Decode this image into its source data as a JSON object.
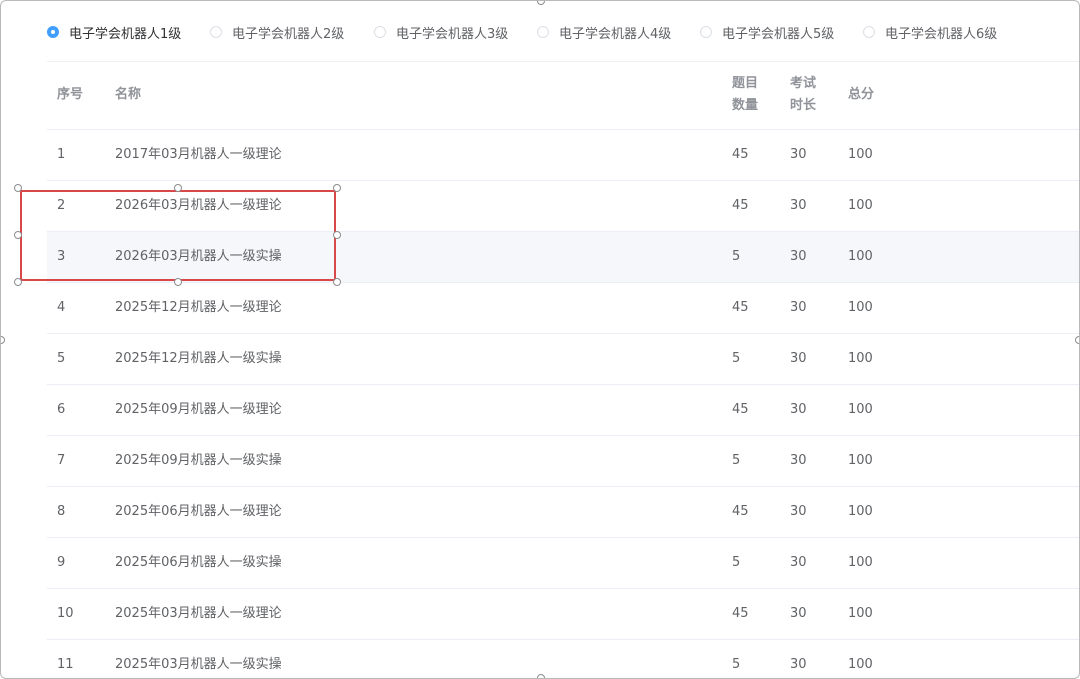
{
  "level_options": [
    {
      "label": "电子学会机器人1级",
      "checked": true
    },
    {
      "label": "电子学会机器人2级",
      "checked": false
    },
    {
      "label": "电子学会机器人3级",
      "checked": false
    },
    {
      "label": "电子学会机器人4级",
      "checked": false
    },
    {
      "label": "电子学会机器人5级",
      "checked": false
    },
    {
      "label": "电子学会机器人6级",
      "checked": false
    }
  ],
  "table": {
    "headers": {
      "no": "序号",
      "name": "名称",
      "questions_line1": "题目",
      "questions_line2": "数量",
      "duration_line1": "考试",
      "duration_line2": "时长",
      "score": "总分"
    },
    "rows": [
      {
        "no": "1",
        "name": "2017年03月机器人一级理论",
        "questions": "45",
        "duration": "30",
        "score": "100"
      },
      {
        "no": "2",
        "name": "2026年03月机器人一级理论",
        "questions": "45",
        "duration": "30",
        "score": "100"
      },
      {
        "no": "3",
        "name": "2026年03月机器人一级实操",
        "questions": "5",
        "duration": "30",
        "score": "100"
      },
      {
        "no": "4",
        "name": "2025年12月机器人一级理论",
        "questions": "45",
        "duration": "30",
        "score": "100"
      },
      {
        "no": "5",
        "name": "2025年12月机器人一级实操",
        "questions": "5",
        "duration": "30",
        "score": "100"
      },
      {
        "no": "6",
        "name": "2025年09月机器人一级理论",
        "questions": "45",
        "duration": "30",
        "score": "100"
      },
      {
        "no": "7",
        "name": "2025年09月机器人一级实操",
        "questions": "5",
        "duration": "30",
        "score": "100"
      },
      {
        "no": "8",
        "name": "2025年06月机器人一级理论",
        "questions": "45",
        "duration": "30",
        "score": "100"
      },
      {
        "no": "9",
        "name": "2025年06月机器人一级实操",
        "questions": "5",
        "duration": "30",
        "score": "100"
      },
      {
        "no": "10",
        "name": "2025年03月机器人一级理论",
        "questions": "45",
        "duration": "30",
        "score": "100"
      },
      {
        "no": "11",
        "name": "2025年03月机器人一级实操",
        "questions": "5",
        "duration": "30",
        "score": "100"
      }
    ]
  },
  "colors": {
    "accent": "#409eff",
    "highlight_box": "#d94848",
    "hover_row": "#f5f7fa"
  }
}
